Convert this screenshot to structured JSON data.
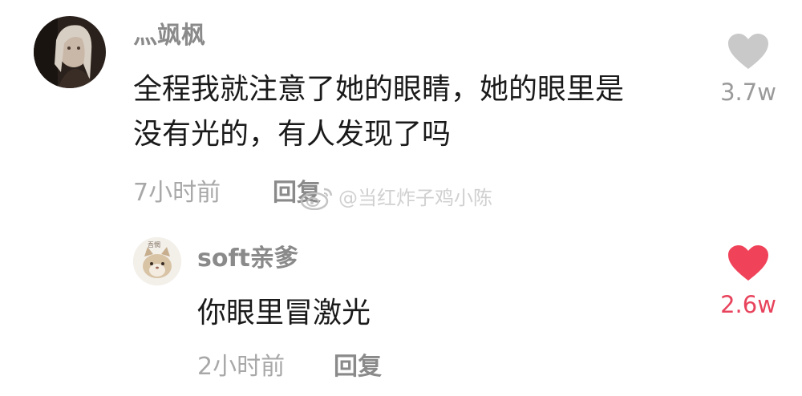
{
  "comments": [
    {
      "username": "灬飒枫",
      "text_lines": [
        "全程我就注意了她的眼睛，她的眼里是",
        "没有光的，有人发现了吗"
      ],
      "time": "7小时前",
      "reply_label": "回复",
      "like_count": "3.7w",
      "liked": false,
      "avatar_icon": "dark-portrait-avatar"
    },
    {
      "username": "soft亲爹",
      "text_lines": [
        "你眼里冒激光"
      ],
      "time": "2小时前",
      "reply_label": "回复",
      "like_count": "2.6w",
      "liked": true,
      "avatar_icon": "cat-avatar",
      "avatar_label": "吾惘"
    }
  ],
  "watermark": {
    "text": "@当红炸子鸡小陈",
    "icon": "weibo-logo-icon"
  },
  "colors": {
    "liked": "#f0435a",
    "unliked": "#c9c9c9",
    "username": "#8a8a8a",
    "meta": "#a8a8a8",
    "text": "#1a1a1a"
  }
}
